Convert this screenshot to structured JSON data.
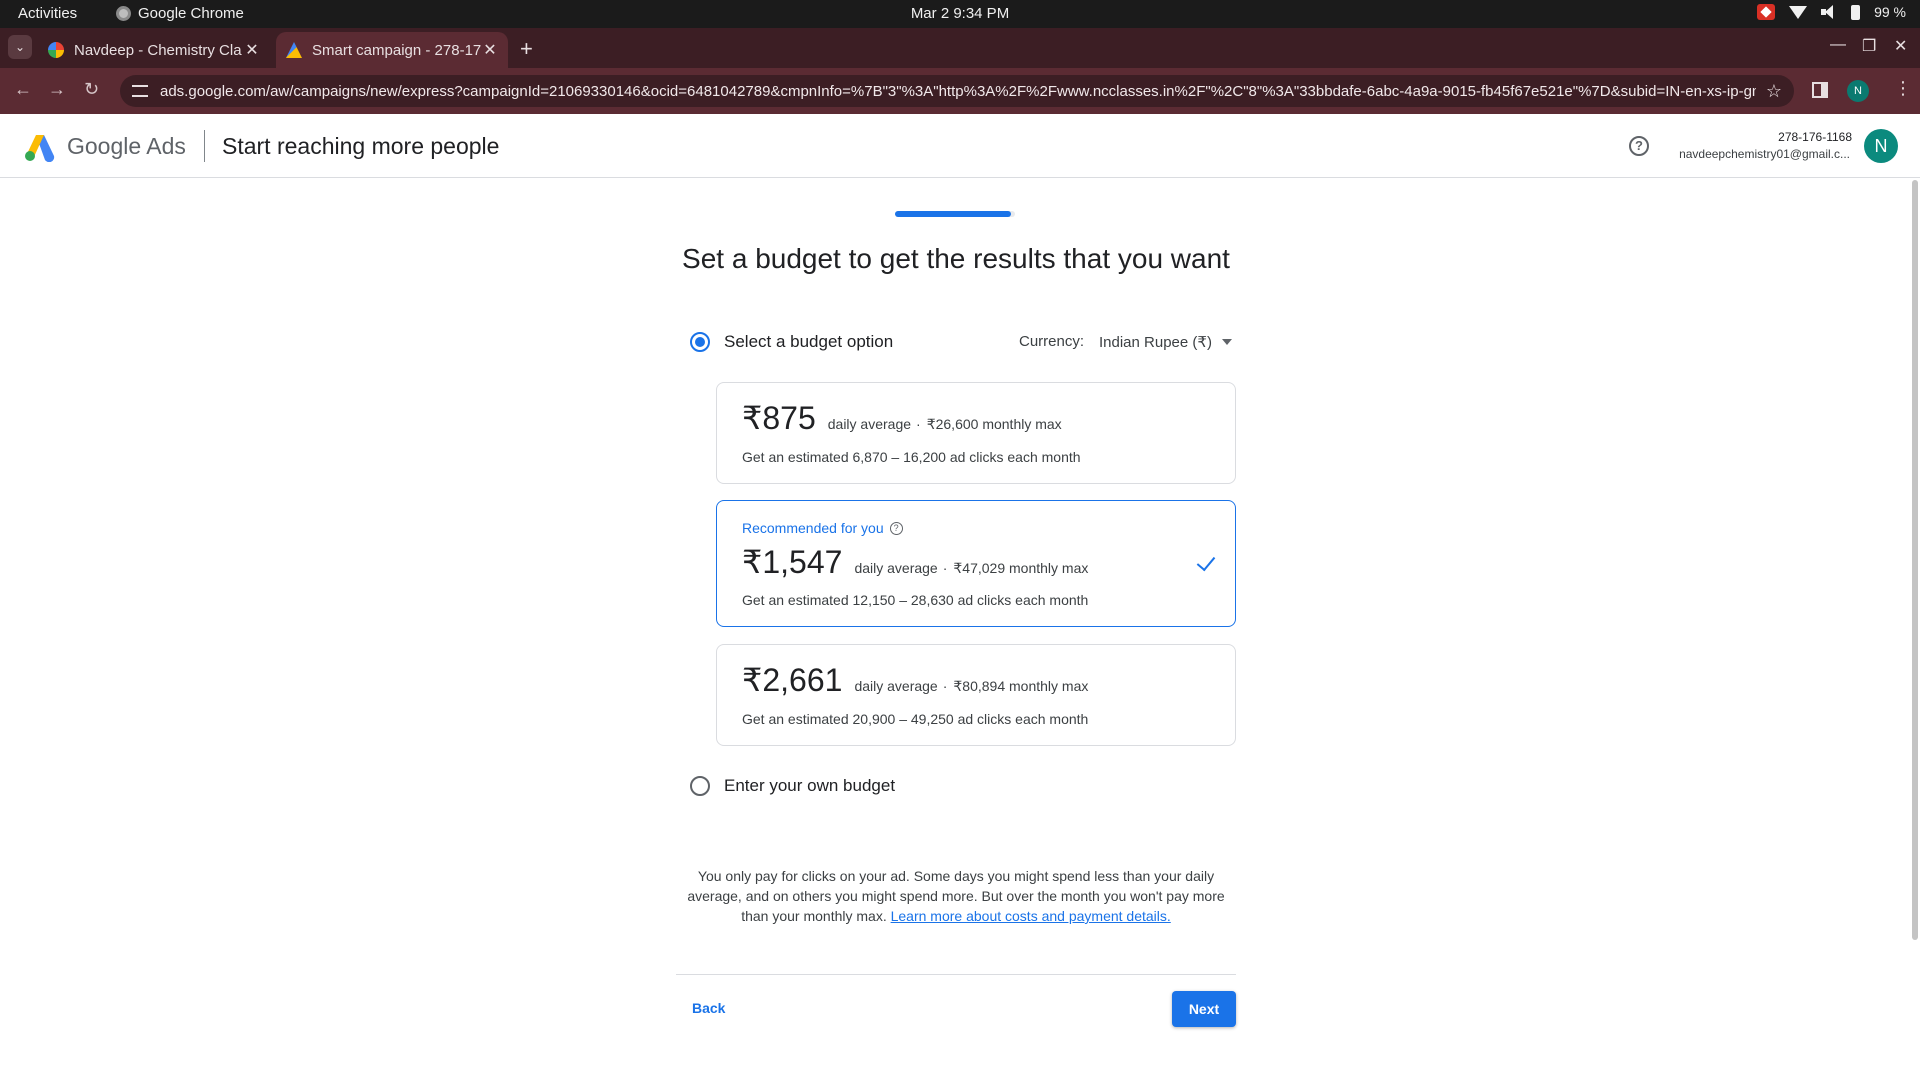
{
  "system_bar": {
    "activities": "Activities",
    "app_name": "Google Chrome",
    "clock": "Mar 2  9:34 PM",
    "battery": "99 %"
  },
  "browser": {
    "tabs": [
      {
        "title": "Navdeep - Chemistry Cla",
        "favicon": "google-g-icon"
      },
      {
        "title": "Smart campaign - 278-17",
        "favicon": "google-ads-icon",
        "active": true
      }
    ],
    "new_tab": "+",
    "url": "ads.google.com/aw/campaigns/new/express?campaignId=21069330146&ocid=6481042789&cmpnInfo=%7B\"3\"%3A\"http%3A%2F%2Fwww.ncclasses.in%2F\"%2C\"8\"%3A\"33bbdafe-6abc-4a9a-9015-fb45f67e521e\"%7D&subid=IN-en-xs-ip-gmb_aw_serp...",
    "profile_initial": "N",
    "theme_colors": {
      "tabstrip": "#3c1e24",
      "toolbar": "#5b2b33"
    }
  },
  "ads_header": {
    "brand": "Google Ads",
    "page_title": "Start reaching more people",
    "account_id": "278-176-1168",
    "account_email": "navdeepchemistry01@gmail.c...",
    "avatar_initial": "N"
  },
  "main": {
    "progress_fraction": 0.97,
    "heading": "Set a budget to get the results that you want",
    "select_option_label": "Select a budget option",
    "currency_label": "Currency:",
    "currency_value": "Indian Rupee (₹)",
    "options": [
      {
        "amount": "₹875",
        "daily": "daily average",
        "monthly": "₹26,600 monthly max",
        "clicks": "Get an estimated 6,870 – 16,200 ad clicks each month"
      },
      {
        "recommended": "Recommended for you",
        "amount": "₹1,547",
        "daily": "daily average",
        "monthly": "₹47,029 monthly max",
        "clicks": "Get an estimated 12,150 – 28,630 ad clicks each month",
        "selected": true
      },
      {
        "amount": "₹2,661",
        "daily": "daily average",
        "monthly": "₹80,894 monthly max",
        "clicks": "Get an estimated 20,900 – 49,250 ad clicks each month"
      }
    ],
    "own_budget_label": "Enter your own budget",
    "footnote": "You only pay for clicks on your ad. Some days you might spend less than your daily average, and on others you might spend more. But over the month you won't pay more than your monthly max.",
    "footnote_link": "Learn more about costs and payment details.",
    "back_label": "Back",
    "next_label": "Next",
    "accent_color": "#1a73e8"
  }
}
